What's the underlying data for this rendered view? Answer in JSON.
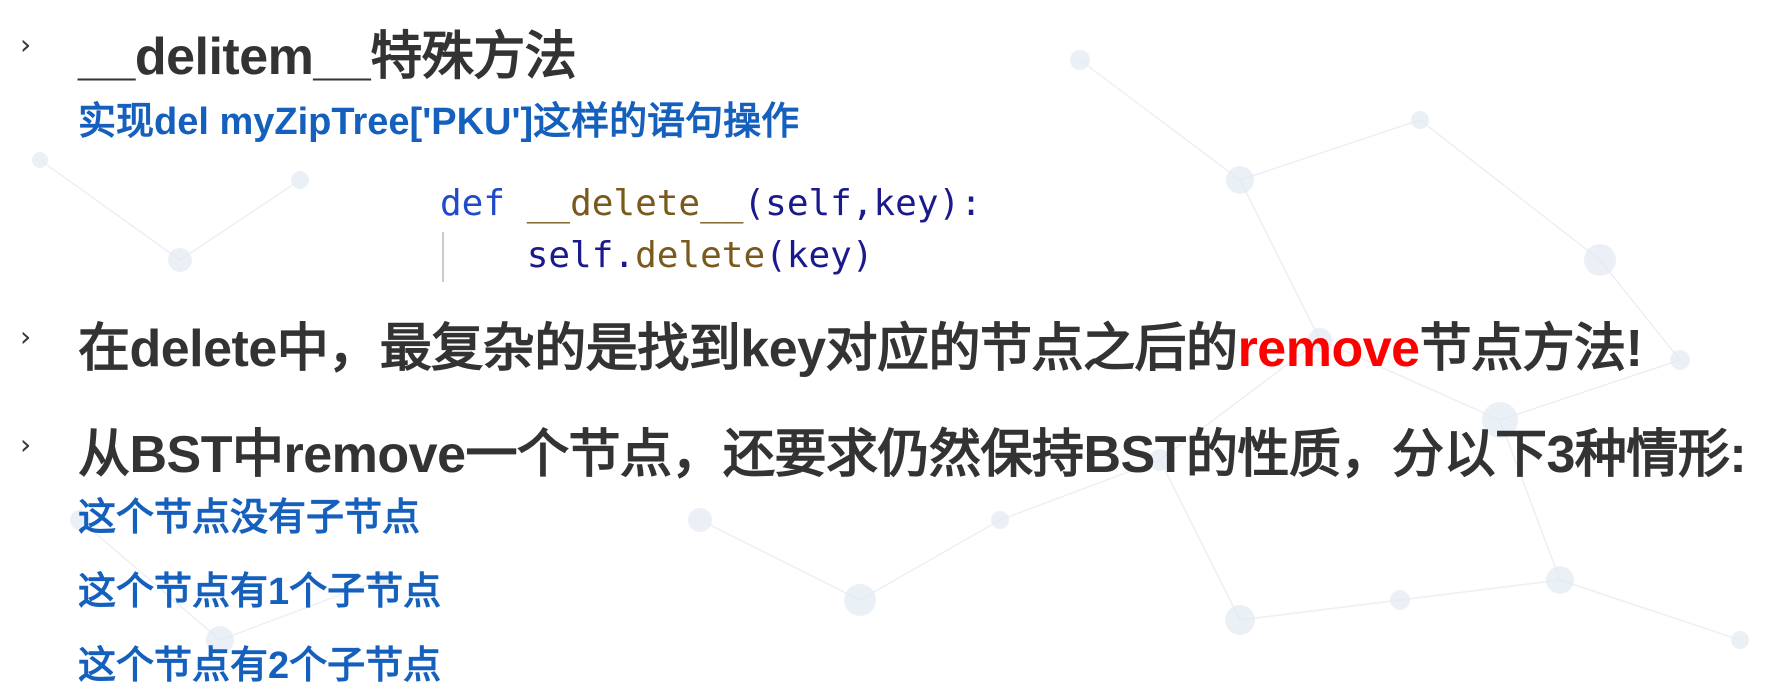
{
  "bullet_glyph": "›",
  "section1": {
    "title": "__delitem__特殊方法",
    "subtitle": "实现del myZipTree['PKU']这样的语句操作"
  },
  "code": {
    "line1": {
      "def": "def",
      "fn": "__delete__",
      "args": "(self,key):"
    },
    "line2": {
      "obj": "self.",
      "method": "delete",
      "args": "(key)"
    }
  },
  "section2": {
    "text_before": "在delete中，最复杂的是找到key对应的节点之后的",
    "highlight": "remove",
    "text_after": "节点方法!"
  },
  "section3": {
    "title": "从BST中remove一个节点，还要求仍然保持BST的性质，分以下3种情形:",
    "cases": [
      "这个节点没有子节点",
      "这个节点有1个子节点",
      "这个节点有2个子节点"
    ]
  },
  "colors": {
    "heading": "#333333",
    "subtitle_blue": "#1560bd",
    "highlight_red": "#ff0000"
  }
}
